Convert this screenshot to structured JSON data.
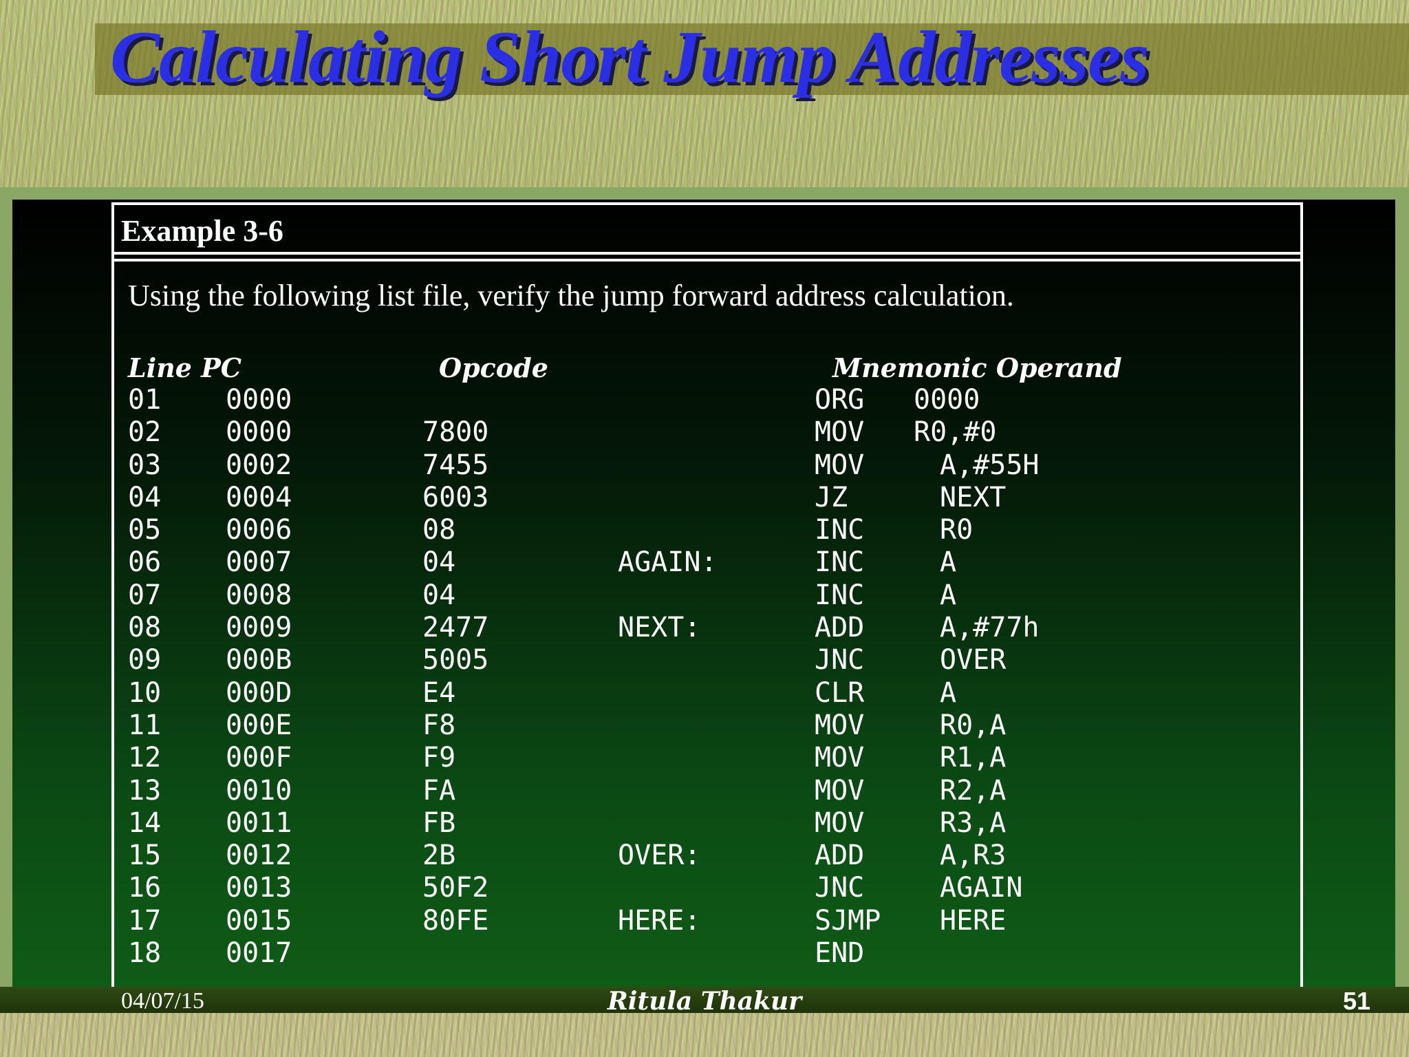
{
  "slide": {
    "title": "Calculating Short Jump Addresses"
  },
  "example": {
    "heading": "Example 3-6",
    "intro": "Using the following list file, verify the jump forward address calculation."
  },
  "listing": {
    "headers": {
      "line_pc": "Line PC",
      "opcode": "Opcode",
      "mnemonic_operand": "Mnemonic Operand"
    },
    "rows": [
      {
        "line": "01",
        "pc": "0000",
        "opcode": "",
        "label": "",
        "mnemonic": "ORG",
        "operand": "0000",
        "shift": false
      },
      {
        "line": "02",
        "pc": "0000",
        "opcode": "7800",
        "label": "",
        "mnemonic": "MOV",
        "operand": "R0,#0",
        "shift": false
      },
      {
        "line": "03",
        "pc": "0002",
        "opcode": "7455",
        "label": "",
        "mnemonic": "MOV",
        "operand": "A,#55H",
        "shift": true
      },
      {
        "line": "04",
        "pc": "0004",
        "opcode": "6003",
        "label": "",
        "mnemonic": "JZ",
        "operand": "NEXT",
        "shift": true
      },
      {
        "line": "05",
        "pc": "0006",
        "opcode": "08",
        "label": "",
        "mnemonic": "INC",
        "operand": "R0",
        "shift": true
      },
      {
        "line": "06",
        "pc": "0007",
        "opcode": "04",
        "label": "AGAIN:",
        "mnemonic": "INC",
        "operand": "A",
        "shift": true
      },
      {
        "line": "07",
        "pc": "0008",
        "opcode": "04",
        "label": "",
        "mnemonic": "INC",
        "operand": "A",
        "shift": true
      },
      {
        "line": "08",
        "pc": "0009",
        "opcode": "2477",
        "label": "NEXT:",
        "mnemonic": "ADD",
        "operand": "A,#77h",
        "shift": true
      },
      {
        "line": "09",
        "pc": "000B",
        "opcode": "5005",
        "label": "",
        "mnemonic": "JNC",
        "operand": "OVER",
        "shift": true
      },
      {
        "line": "10",
        "pc": "000D",
        "opcode": "E4",
        "label": "",
        "mnemonic": "CLR",
        "operand": "A",
        "shift": true
      },
      {
        "line": "11",
        "pc": "000E",
        "opcode": "F8",
        "label": "",
        "mnemonic": "MOV",
        "operand": "R0,A",
        "shift": true
      },
      {
        "line": "12",
        "pc": "000F",
        "opcode": "F9",
        "label": "",
        "mnemonic": "MOV",
        "operand": "R1,A",
        "shift": true
      },
      {
        "line": "13",
        "pc": "0010",
        "opcode": "FA",
        "label": "",
        "mnemonic": "MOV",
        "operand": "R2,A",
        "shift": true
      },
      {
        "line": "14",
        "pc": "0011",
        "opcode": "FB",
        "label": "",
        "mnemonic": "MOV",
        "operand": "R3,A",
        "shift": true
      },
      {
        "line": "15",
        "pc": "0012",
        "opcode": "2B",
        "label": "OVER:",
        "mnemonic": "ADD",
        "operand": "A,R3",
        "shift": true
      },
      {
        "line": "16",
        "pc": "0013",
        "opcode": "50F2",
        "label": "",
        "mnemonic": "JNC",
        "operand": "AGAIN",
        "shift": true
      },
      {
        "line": "17",
        "pc": "0015",
        "opcode": "80FE",
        "label": "HERE:",
        "mnemonic": "SJMP",
        "operand": "HERE",
        "shift": true
      },
      {
        "line": "18",
        "pc": "0017",
        "opcode": "",
        "label": "",
        "mnemonic": "END",
        "operand": "",
        "shift": false
      }
    ]
  },
  "footer": {
    "date": "04/07/15",
    "author": "Ritula Thakur",
    "page": "51"
  }
}
